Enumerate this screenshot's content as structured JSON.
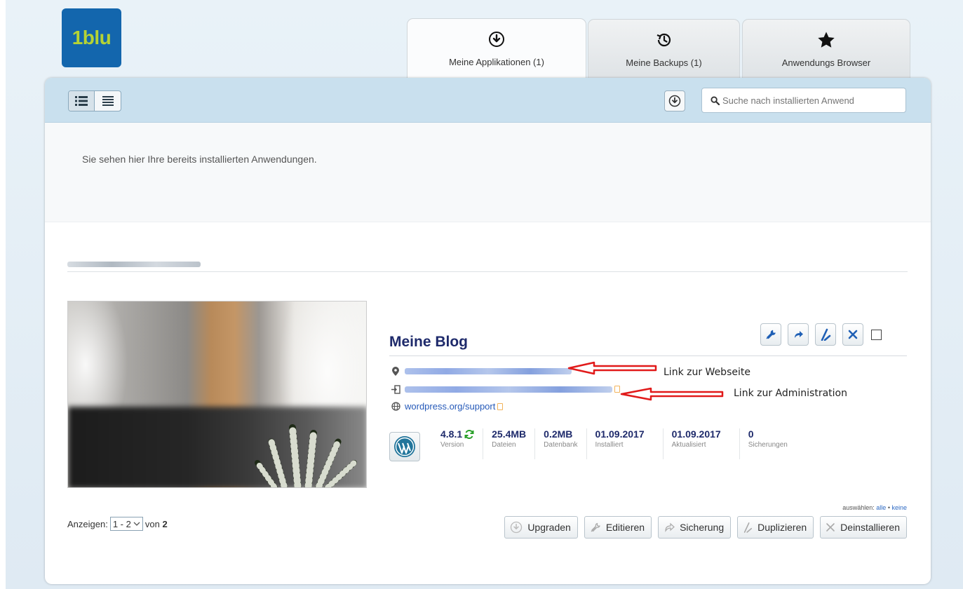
{
  "brand": {
    "logo_text": "1blu",
    "bg_color": "#1366ad",
    "text_color": "#b5d334"
  },
  "tabs": [
    {
      "label": "Meine Applikationen (1)",
      "icon": "download-circle-icon",
      "active": true
    },
    {
      "label": "Meine Backups (1)",
      "icon": "history-clock-icon",
      "active": false
    },
    {
      "label": "Anwendungs Browser",
      "icon": "star-icon",
      "active": false
    }
  ],
  "toolbar": {
    "search_placeholder": "Suche nach installierten Anwend"
  },
  "info_text": "Sie sehen hier Ihre bereits installierten Anwendungen.",
  "app": {
    "title": "Meine Blog",
    "support_link": "wordpress.org/support",
    "stats": [
      {
        "value": "4.8.1",
        "label": "Version"
      },
      {
        "value": "25.4MB",
        "label": "Dateien"
      },
      {
        "value": "0.2MB",
        "label": "Datenbank"
      },
      {
        "value": "01.09.2017",
        "label": "Installiert"
      },
      {
        "value": "01.09.2017",
        "label": "Aktualisiert"
      },
      {
        "value": "0",
        "label": "Sicherungen"
      }
    ]
  },
  "annotations": {
    "website": "Link zur Webseite",
    "admin": "Link zur Administration",
    "arrow_color": "#e11a1a"
  },
  "pager": {
    "prefix": "Anzeigen:",
    "range": "1 - 2",
    "suffix": "von",
    "total": "2"
  },
  "select": {
    "label": "auswählen:",
    "all": "alle",
    "sep": "•",
    "none": "keine"
  },
  "bottom_buttons": {
    "upgrade": "Upgraden",
    "edit": "Editieren",
    "backup": "Sicherung",
    "clone": "Duplizieren",
    "uninstall": "Deinstallieren"
  }
}
